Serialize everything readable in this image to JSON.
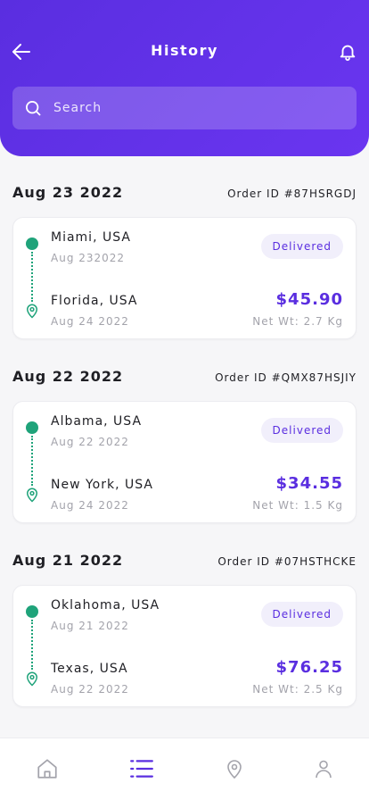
{
  "header": {
    "title": "History",
    "back_icon": "arrow-left-icon",
    "bell_icon": "bell-icon"
  },
  "search": {
    "placeholder": "Search",
    "value": "",
    "icon": "search-icon"
  },
  "orders": [
    {
      "date": "Aug 23 2022",
      "order_id": "Order ID #87HSRGDJ",
      "from_location": "Miami, USA",
      "from_date": "Aug 232022",
      "to_location": "Florida, USA",
      "to_date": "Aug 24 2022",
      "status": "Delivered",
      "price": "$45.90",
      "net_weight": "Net Wt: 2.7 Kg"
    },
    {
      "date": "Aug 22 2022",
      "order_id": "Order ID #QMX87HSJIY",
      "from_location": "Albama, USA",
      "from_date": "Aug 22 2022",
      "to_location": "New York, USA",
      "to_date": "Aug 24 2022",
      "status": "Delivered",
      "price": "$34.55",
      "net_weight": "Net Wt: 1.5 Kg"
    },
    {
      "date": "Aug 21 2022",
      "order_id": "Order ID #07HSTHCKE",
      "from_location": "Oklahoma, USA",
      "from_date": "Aug 21 2022",
      "to_location": "Texas, USA",
      "to_date": "Aug 22 2022",
      "status": "Delivered",
      "price": "$76.25",
      "net_weight": "Net Wt: 2.5 Kg"
    }
  ],
  "tabbar": {
    "items": [
      {
        "icon": "home-icon",
        "active": false
      },
      {
        "icon": "list-icon",
        "active": true
      },
      {
        "icon": "location-pin-icon",
        "active": false
      },
      {
        "icon": "profile-icon",
        "active": false
      }
    ]
  },
  "colors": {
    "brand": "#5a2ee0",
    "route_green": "#1fa37a",
    "muted_text": "#a3a3ab",
    "badge_bg": "#f1effb",
    "inactive_icon": "#a3a3ab"
  }
}
